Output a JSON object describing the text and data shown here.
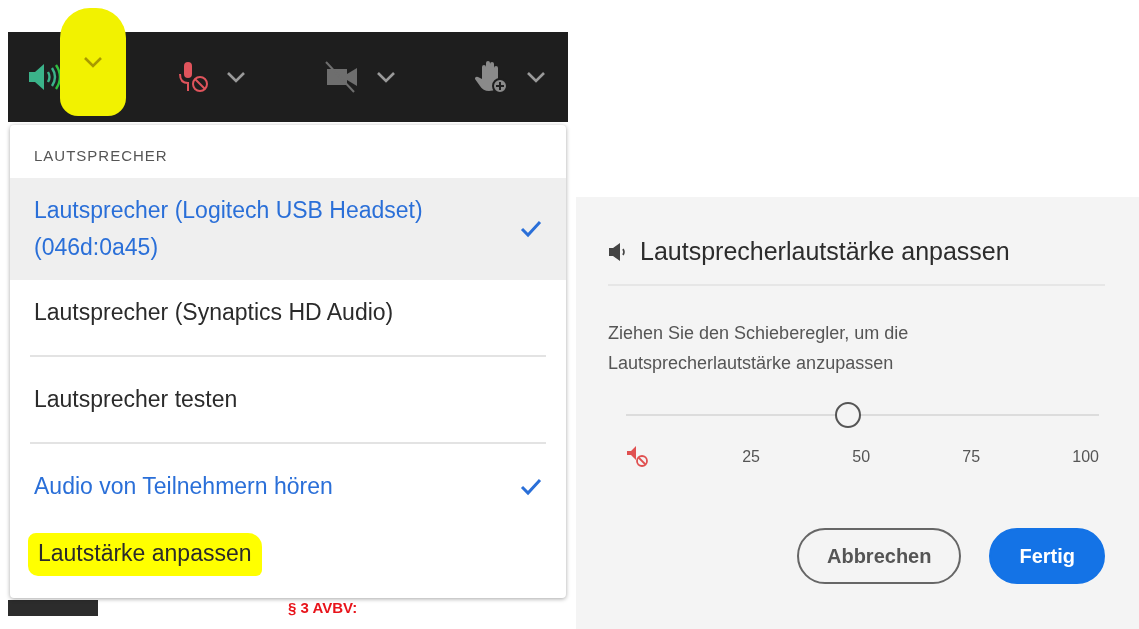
{
  "toolbar": {
    "items": [
      {
        "kind": "speaker",
        "on": true,
        "highlighted": true
      },
      {
        "kind": "microphone",
        "on": false,
        "highlighted": false
      },
      {
        "kind": "camera",
        "on": false,
        "highlighted": false
      },
      {
        "kind": "hand",
        "on": false,
        "highlighted": false
      }
    ]
  },
  "menu": {
    "header": "LAUTSPRECHER",
    "items": [
      {
        "kind": "option",
        "label": "Lautsprecher (Logitech USB Headset) (046d:0a45)",
        "selected": true,
        "highlighted": false
      },
      {
        "kind": "option",
        "label": "Lautsprecher (Synaptics HD Audio)",
        "selected": false,
        "highlighted": false
      },
      {
        "kind": "divider"
      },
      {
        "kind": "action",
        "label": "Lautsprecher testen",
        "highlighted": false
      },
      {
        "kind": "divider"
      },
      {
        "kind": "toggle",
        "label": "Audio von Teilnehmern hören",
        "checked": true,
        "highlighted": false
      },
      {
        "kind": "action",
        "label": "Lautstärke anpassen",
        "highlighted": true
      }
    ]
  },
  "background_text": "§ 3 AVBV:",
  "dialog": {
    "title": "Lautsprecherlautstärke anpassen",
    "description": "Ziehen Sie den Schieberegler, um die Lautsprecherlautstärke anzupassen",
    "slider": {
      "level": 0.47,
      "ticks": [
        "25",
        "50",
        "75",
        "100"
      ]
    },
    "buttons": [
      {
        "kind": "secondary",
        "label": "Abbrechen"
      },
      {
        "kind": "primary",
        "label": "Fertig"
      }
    ]
  }
}
